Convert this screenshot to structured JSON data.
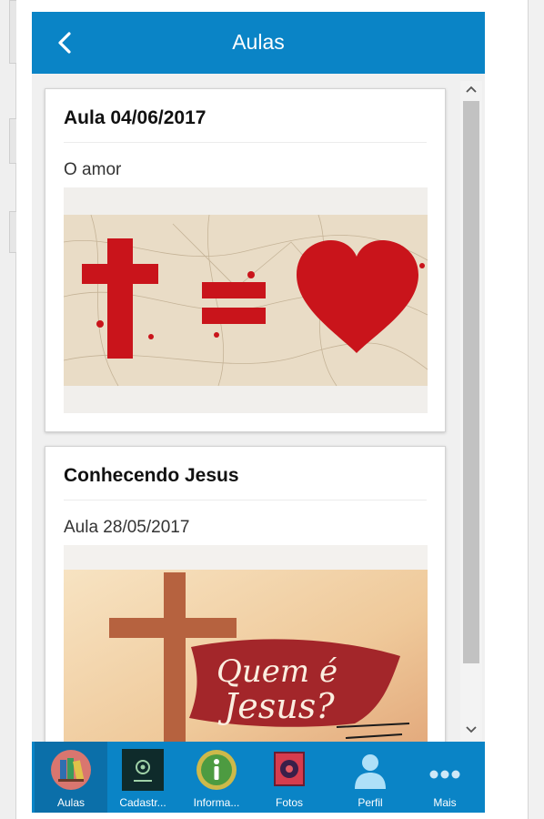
{
  "header": {
    "title": "Aulas"
  },
  "lessons": [
    {
      "title": "Aula 04/06/2017",
      "subtitle": "O amor"
    },
    {
      "title": "Conhecendo Jesus",
      "subtitle": "Aula 28/05/2017",
      "image_text_line1": "Quem é",
      "image_text_line2": "Jesus?"
    }
  ],
  "tabs": [
    {
      "label": "Aulas",
      "icon": "books-icon"
    },
    {
      "label": "Cadastr...",
      "icon": "register-icon"
    },
    {
      "label": "Informa...",
      "icon": "info-icon"
    },
    {
      "label": "Fotos",
      "icon": "photos-icon"
    },
    {
      "label": "Perfil",
      "icon": "profile-icon"
    },
    {
      "label": "Mais",
      "icon": "more-icon"
    }
  ],
  "colors": {
    "header": "#0a84c6",
    "tab_active": "#0b6fa9",
    "accent_red": "#c9141b"
  }
}
